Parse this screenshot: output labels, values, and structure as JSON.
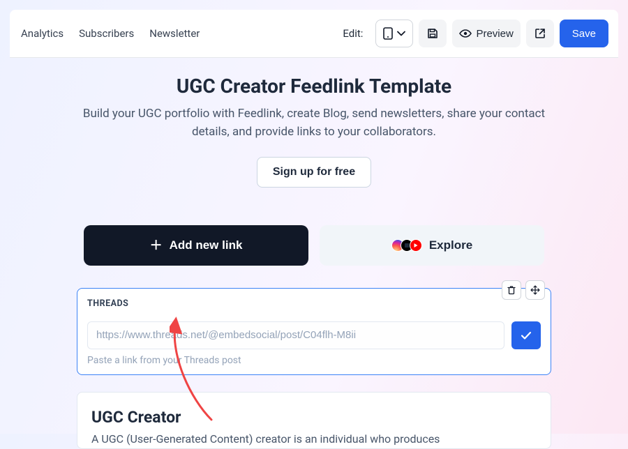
{
  "nav": {
    "items": [
      "Analytics",
      "Subscribers",
      "Newsletter"
    ]
  },
  "toolbar": {
    "edit_label": "Edit:",
    "preview_label": "Preview",
    "save_label": "Save"
  },
  "hero": {
    "title": "UGC Creator Feedlink Template",
    "subtitle": "Build your UGC portfolio with Feedlink, create Blog, send newsletters, share your contact details, and provide links to your collaborators.",
    "signup_label": "Sign up for free"
  },
  "actions": {
    "add_link_label": "Add new link",
    "explore_label": "Explore"
  },
  "threads": {
    "section_label": "THREADS",
    "placeholder": "https://www.threads.net/@embedsocial/post/C04flh-M8ii",
    "helper": "Paste a link from your Threads post"
  },
  "info_card": {
    "title": "UGC Creator",
    "body": "A UGC (User-Generated Content) creator is an individual who produces"
  },
  "colors": {
    "accent": "#2563eb"
  }
}
